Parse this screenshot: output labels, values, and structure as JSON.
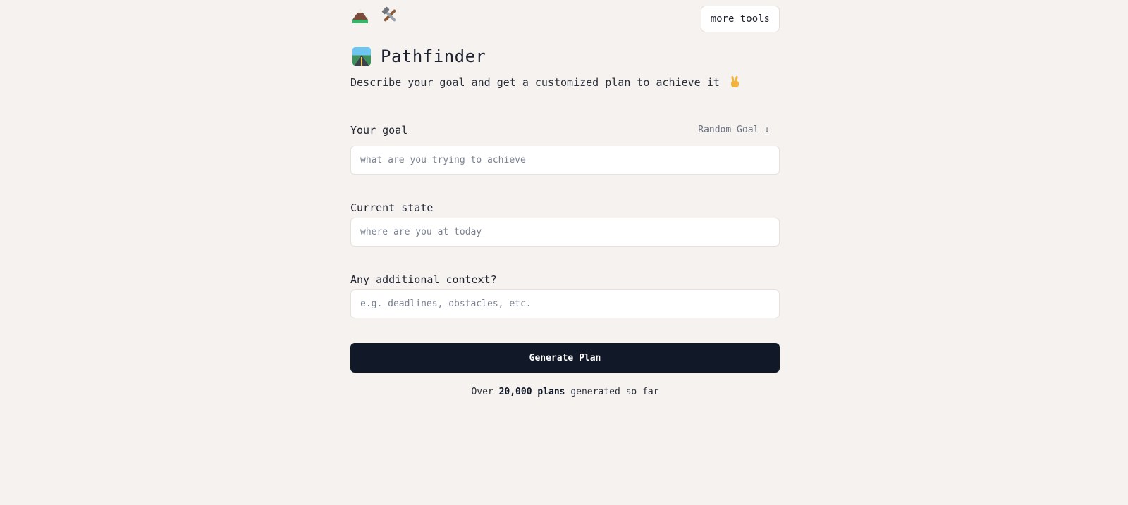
{
  "header": {
    "icons": [
      "mountain-icon",
      "tools-icon"
    ],
    "more_tools_label": "more tools"
  },
  "hero": {
    "title_icon": "road-icon",
    "title": "Pathfinder",
    "subtitle": "Describe your goal and get a customized plan to achieve it",
    "subtitle_icon": "victory-hand-icon"
  },
  "form": {
    "goal": {
      "label": "Your goal",
      "random_label": "Random Goal ↓",
      "placeholder": "what are you trying to achieve",
      "value": ""
    },
    "current": {
      "label": "Current state",
      "placeholder": "where are you at today",
      "value": ""
    },
    "context": {
      "label": "Any additional context?",
      "placeholder": "e.g. deadlines, obstacles, etc.",
      "value": ""
    },
    "submit_label": "Generate Plan"
  },
  "stats": {
    "prefix": "Over",
    "count": "20,000 plans",
    "suffix": "generated so far"
  },
  "colors": {
    "background": "#f6f2ef",
    "button": "#111827",
    "muted": "#6b7280"
  }
}
